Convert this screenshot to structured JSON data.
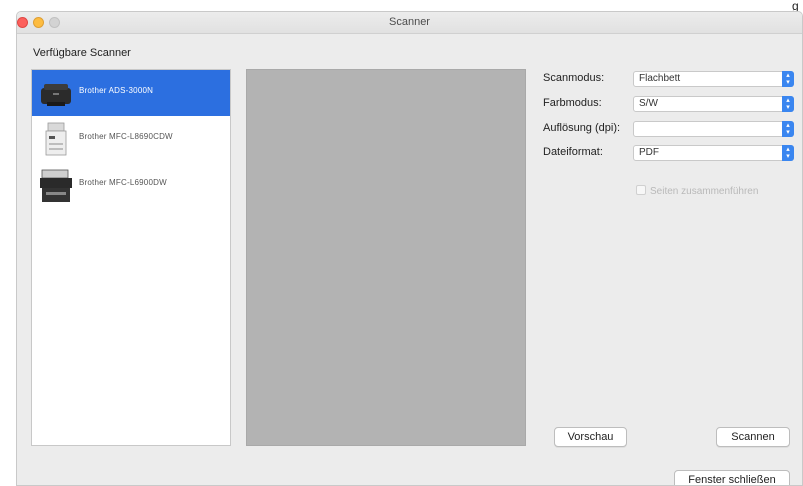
{
  "corner_glyph": "g",
  "window": {
    "title": "Scanner"
  },
  "scanners": {
    "heading": "Verfügbare Scanner",
    "items": [
      {
        "label": "Brother ADS-3000N",
        "icon": "document-scanner-icon",
        "selected": true
      },
      {
        "label": "Brother MFC-L8690CDW",
        "icon": "laser-printer-icon",
        "selected": false
      },
      {
        "label": "Brother MFC-L6900DW",
        "icon": "multifunction-printer-icon",
        "selected": false
      }
    ]
  },
  "settings": {
    "scan_mode": {
      "label": "Scanmodus:",
      "value": "Flachbett"
    },
    "color_mode": {
      "label": "Farbmodus:",
      "value": "S/W"
    },
    "resolution": {
      "label": "Auflösung (dpi):",
      "value": ""
    },
    "file_format": {
      "label": "Dateiformat:",
      "value": "PDF"
    },
    "merge_pages": {
      "label": "Seiten zusammenführen",
      "checked": false,
      "enabled": false
    }
  },
  "buttons": {
    "preview": "Vorschau",
    "scan": "Scannen",
    "close_window": "Fenster schließen"
  },
  "colors": {
    "selection": "#2c6fe0",
    "select_arrow": "#3a86f0",
    "preview_bg": "#b3b3b3"
  }
}
